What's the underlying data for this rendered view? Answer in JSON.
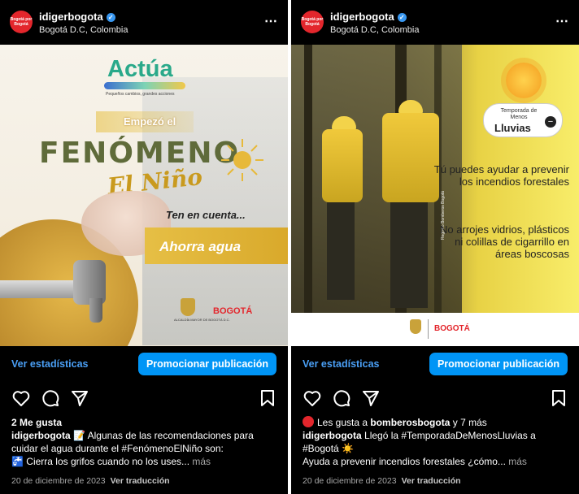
{
  "posts": [
    {
      "username": "idigerbogota",
      "avatar_text": "Bogotá por Bogotá",
      "location": "Bogotá D.C, Colombia",
      "more_icon": "⋯",
      "media": {
        "actua": "Actúa",
        "actua_sub": "Pequeños cambios, grandes acciones",
        "empezo": "Empezó el",
        "fenomeno": "FENÓMENO",
        "elnino": "El Niño",
        "ten_cuenta": "Ten en cuenta...",
        "ahorra": "Ahorra agua",
        "alcaldia": "ALCALDÍA MAYOR DE BOGOTÁ D.C.",
        "bogota_logo": "BOGOTÁ"
      },
      "stats_label": "Ver estadísticas",
      "promote_label": "Promocionar publicación",
      "likes_text": "2 Me gusta",
      "caption_user": "idigerbogota",
      "caption_line1": "📝 Algunas de las recomendaciones para",
      "caption_line2": "cuidar el agua durante el #FenómenoElNiño son:",
      "caption_line3": "🚰 Cierra los grifos cuando no los uses...",
      "more_label": "más",
      "date": "20 de diciembre de 2023",
      "translate": "Ver traducción"
    },
    {
      "username": "idigerbogota",
      "avatar_text": "Bogotá por Bogotá",
      "location": "Bogotá D.C, Colombia",
      "more_icon": "⋯",
      "media": {
        "temp_small": "Temporada de Menos",
        "temp_big": "Lluvias",
        "minus": "−",
        "text1": "Tú puedes ayudar a prevenir los incendios forestales",
        "text2": "No arrojes vidrios, plásticos ni colillas de cigarrillo en áreas boscosas",
        "credit": "Registro Bomberos Bogotá",
        "bogota_logo": "BOGOTÁ"
      },
      "stats_label": "Ver estadísticas",
      "promote_label": "Promocionar publicación",
      "likes_prefix": "Les gusta a",
      "likes_user": "bomberosbogota",
      "likes_suffix": "y 7 más",
      "caption_user": "idigerbogota",
      "caption_line1": "Llegó la #TemporadaDeMenosLluvias a",
      "caption_line2": "#Bogotá ☀️",
      "caption_line3": "Ayuda a prevenir incendios forestales ¿cómo...",
      "more_label": "más",
      "date": "20 de diciembre de 2023",
      "translate": "Ver traducción"
    }
  ],
  "icons": [
    "heart-icon",
    "comment-icon",
    "share-icon",
    "bookmark-icon",
    "verified-icon"
  ],
  "colors": {
    "accent": "#0095f6",
    "link": "#4a9ff5",
    "brand_red": "#e3262c"
  }
}
